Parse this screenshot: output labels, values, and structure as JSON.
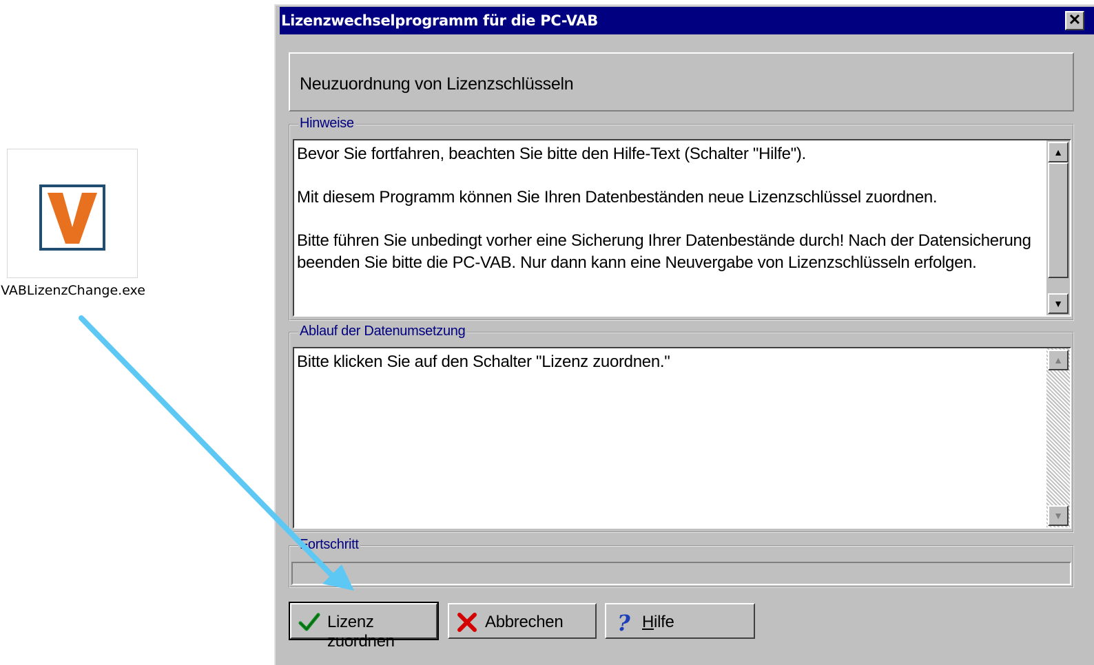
{
  "desktop_icon": {
    "label": "VABLizenzChange.exe",
    "brand_color": "#e8711f",
    "frame_color": "#1f4e72"
  },
  "window": {
    "title": "Lizenzwechselprogramm für die PC-VAB",
    "close_symbol": "✕"
  },
  "header": {
    "text": "Neuzuordnung von Lizenzschlüsseln"
  },
  "hinweise": {
    "legend": "Hinweise",
    "paragraphs": [
      "Bevor Sie fortfahren, beachten Sie bitte den Hilfe-Text (Schalter \"Hilfe\").",
      "Mit diesem Programm können Sie Ihren Datenbeständen neue Lizenzschlüssel zuordnen.",
      "Bitte führen Sie unbedingt vorher eine Sicherung Ihrer Datenbestände durch! Nach der Datensicherung beenden Sie bitte die PC-VAB. Nur dann kann eine Neuvergabe von Lizenzschlüsseln erfolgen."
    ]
  },
  "ablauf": {
    "legend": "Ablauf der Datenumsetzung",
    "text": "Bitte klicken Sie auf den Schalter \"Lizenz zuordnen.\""
  },
  "fortschritt": {
    "legend": "Fortschritt",
    "progress": 0
  },
  "buttons": {
    "assign": {
      "label": "Lizenz zuordnen",
      "icon": "checkmark-icon"
    },
    "cancel": {
      "label": "Abbrechen",
      "icon": "red-x-icon"
    },
    "help": {
      "label_underlined": "H",
      "label_rest": "ilfe",
      "icon": "question-mark-icon"
    }
  },
  "annotation_arrow": {
    "color": "#5ec8f5"
  }
}
